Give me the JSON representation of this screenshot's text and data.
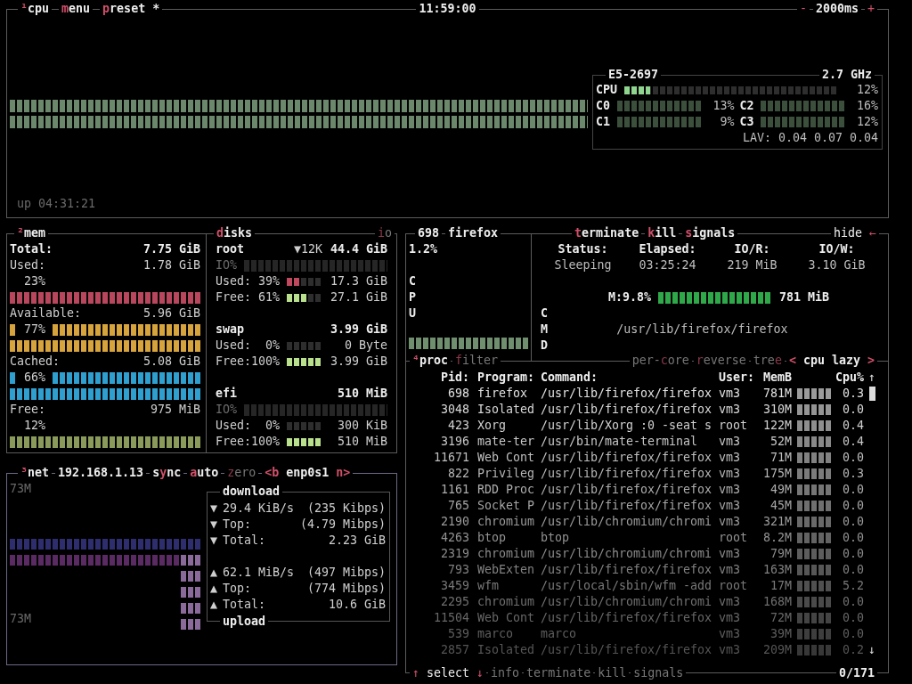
{
  "cpu_panel": {
    "tabs": [
      {
        "parts": [
          {
            "text": "¹",
            "hot": true
          },
          {
            "text": "cpu",
            "hot": false
          }
        ],
        "on": true
      },
      {
        "parts": [
          {
            "text": "m",
            "hot": true
          },
          {
            "text": "enu",
            "hot": false
          }
        ],
        "on": true
      },
      {
        "parts": [
          {
            "text": "p",
            "hot": true
          },
          {
            "text": "reset *",
            "hot": false
          }
        ],
        "on": true
      }
    ],
    "clock": "11:59:00",
    "interval": {
      "minus": "-",
      "value": "2000ms",
      "plus": "+"
    },
    "uptime": "up 04:31:21",
    "cpu_info": {
      "model": "E5-2697",
      "freq": "2.7 GHz",
      "total": {
        "label": "CPU",
        "level": 0.12,
        "reading": "12%"
      },
      "cores": [
        {
          "label": "C0",
          "reading": "13%"
        },
        {
          "label": "C2",
          "reading": "16%"
        },
        {
          "label": "C1",
          "reading": "9%"
        },
        {
          "label": "C3",
          "reading": "12%"
        }
      ],
      "load_average": "LAV: 0.04 0.07 0.04"
    }
  },
  "mem_panel": {
    "tab": {
      "parts": [
        {
          "text": "²",
          "hot": true
        },
        {
          "text": "mem",
          "hot": false
        }
      ],
      "on": true
    },
    "total": {
      "label": "Total:",
      "value": "7.75 GiB"
    },
    "stats": [
      {
        "kind": "short",
        "label": "Used:",
        "value": "1.78 GiB",
        "percent": "23%",
        "color": "#b8475e"
      },
      {
        "kind": "tall",
        "label": "Available:",
        "value": "5.96 GiB",
        "percent": "77%",
        "color": "#d6a33c"
      },
      {
        "kind": "tall",
        "label": "Cached:",
        "value": "5.08 GiB",
        "percent": "66%",
        "color": "#2f9fd0"
      },
      {
        "kind": "short",
        "label": "Free:",
        "value": "975 MiB",
        "percent": "12%",
        "color": "#8a9a5a"
      }
    ]
  },
  "disks_panel": {
    "tab": {
      "parts": [
        {
          "text": "d",
          "hot": true
        },
        {
          "text": "isks",
          "hot": false
        }
      ],
      "on": true
    },
    "io_tab": {
      "parts": [
        {
          "text": "i",
          "hot": true
        },
        {
          "text": "o",
          "hot": false
        }
      ],
      "on": false
    },
    "disks": [
      {
        "name": "root",
        "io_rate": "▼12K",
        "size": "44.4 GiB",
        "io_meter": true,
        "io_label": "IO%",
        "used": {
          "label": "Used: 39%",
          "level": 0.39,
          "value": "17.3 GiB"
        },
        "free": {
          "label": "Free: 61%",
          "level": 0.61,
          "value": "27.1 GiB"
        }
      },
      {
        "name": "swap",
        "size": "3.99 GiB",
        "io_meter": false,
        "used": {
          "label": "Used:  0%",
          "level": 0,
          "value": "0 Byte"
        },
        "free": {
          "label": "Free:100%",
          "level": 1,
          "value": "3.99 GiB"
        }
      },
      {
        "name": "efi",
        "size": "510 MiB",
        "io_meter": true,
        "io_label": "IO%",
        "used": {
          "label": "Used:  0%",
          "level": 0,
          "value": "300 KiB"
        },
        "free": {
          "label": "Free:100%",
          "level": 1,
          "value": "510 MiB"
        }
      }
    ]
  },
  "net_panel": {
    "tabs": [
      {
        "parts": [
          {
            "text": "³",
            "hot": true
          },
          {
            "text": "net",
            "hot": false
          }
        ],
        "on": true
      },
      {
        "parts": [
          {
            "text": "192.168.1.13",
            "hot": false
          }
        ],
        "on": true
      },
      {
        "parts": [
          {
            "text": "s",
            "hot": false
          },
          {
            "text": "y",
            "hot": true
          },
          {
            "text": "nc",
            "hot": false
          }
        ],
        "on": true
      },
      {
        "parts": [
          {
            "text": "a",
            "hot": true
          },
          {
            "text": "uto",
            "hot": false
          }
        ],
        "on": true
      },
      {
        "parts": [
          {
            "text": "z",
            "hot": true
          },
          {
            "text": "ero",
            "hot": false
          }
        ],
        "on": false
      },
      {
        "parts": [
          {
            "text": "<b",
            "hot": true
          },
          {
            "text": " enp0s1 ",
            "hot": false
          },
          {
            "text": "n>",
            "hot": true
          }
        ],
        "on": true
      }
    ],
    "scale_top": "73M",
    "scale_bottom": "73M",
    "download": {
      "title": "download",
      "rows": [
        {
          "arrow": "▼",
          "label": "29.4 KiB/s",
          "value": "(235 Kibps)"
        },
        {
          "arrow": "▼",
          "label": "Top:",
          "value": "(4.79 Mibps)"
        },
        {
          "arrow": "▼",
          "label": "Total:",
          "value": "2.23 GiB"
        }
      ]
    },
    "upload": {
      "title": "upload",
      "rows": [
        {
          "arrow": "▲",
          "label": "62.1 MiB/s",
          "value": "(497 Mibps)"
        },
        {
          "arrow": "▲",
          "label": "Top:",
          "value": "(774 Mibps)"
        },
        {
          "arrow": "▲",
          "label": "Total:",
          "value": "10.6 GiB"
        }
      ]
    }
  },
  "process_detail": {
    "pid": "698",
    "name": "firefox",
    "cpu": "1.2%",
    "cpu_label": "CPU",
    "buttons": [
      {
        "parts": [
          {
            "text": "t",
            "hot": true
          },
          {
            "text": "erminate",
            "hot": false
          }
        ],
        "on": true
      },
      {
        "parts": [
          {
            "text": "k",
            "hot": true
          },
          {
            "text": "ill",
            "hot": false
          }
        ],
        "on": true
      },
      {
        "parts": [
          {
            "text": "s",
            "hot": true
          },
          {
            "text": "ignals",
            "hot": false
          }
        ],
        "on": true
      }
    ],
    "hide": {
      "label": "hide",
      "arrow": "←"
    },
    "stats": [
      {
        "label": "Status:",
        "value": "Sleeping"
      },
      {
        "label": "Elapsed:",
        "value": "03:25:24"
      },
      {
        "label": "IO/R:",
        "value": "219 MiB"
      },
      {
        "label": "IO/W:",
        "value": "3.10 GiB"
      }
    ],
    "mem": {
      "label": "M:9.8%",
      "value": "781 MiB"
    },
    "cmd_label": "CMD",
    "command": "/usr/lib/firefox/firefox"
  },
  "process_list": {
    "tabs": [
      {
        "parts": [
          {
            "text": "⁴",
            "hot": true
          },
          {
            "text": "proc",
            "hot": false
          }
        ],
        "on": true
      },
      {
        "parts": [
          {
            "text": "f",
            "hot": true
          },
          {
            "text": "ilter",
            "hot": false
          }
        ],
        "on": false
      }
    ],
    "options": [
      {
        "parts": [
          {
            "text": "per-",
            "hot": false
          },
          {
            "text": "c",
            "hot": true
          },
          {
            "text": "ore",
            "hot": false
          }
        ],
        "on": false
      },
      {
        "parts": [
          {
            "text": "r",
            "hot": true
          },
          {
            "text": "everse",
            "hot": false
          }
        ],
        "on": false
      },
      {
        "parts": [
          {
            "text": "tre",
            "hot": false
          },
          {
            "text": "e",
            "hot": true
          }
        ],
        "on": false
      },
      {
        "parts": [
          {
            "text": "<",
            "hot": true
          },
          {
            "text": " cpu lazy ",
            "hot": false
          },
          {
            "text": ">",
            "hot": true
          }
        ],
        "on": true
      }
    ],
    "columns": [
      "Pid:",
      "Program:",
      "Command:",
      "User:",
      "MemB",
      "Cpu%"
    ],
    "rows": [
      {
        "pid": "698",
        "program": "firefox",
        "command": "/usr/lib/firefox/firefox",
        "user": "vm3",
        "mem": "781M",
        "cpu": "0.3"
      },
      {
        "pid": "3048",
        "program": "Isolated",
        "command": "/usr/lib/firefox/firefox",
        "user": "vm3",
        "mem": "310M",
        "cpu": "0.0"
      },
      {
        "pid": "423",
        "program": "Xorg",
        "command": "/usr/lib/Xorg :0 -seat s",
        "user": "root",
        "mem": "122M",
        "cpu": "0.4"
      },
      {
        "pid": "3196",
        "program": "mate-ter",
        "command": "/usr/bin/mate-terminal",
        "user": "vm3",
        "mem": "52M",
        "cpu": "0.4"
      },
      {
        "pid": "11671",
        "program": "Web Cont",
        "command": "/usr/lib/firefox/firefox",
        "user": "vm3",
        "mem": "71M",
        "cpu": "0.0"
      },
      {
        "pid": "822",
        "program": "Privileg",
        "command": "/usr/lib/firefox/firefox",
        "user": "vm3",
        "mem": "175M",
        "cpu": "0.3"
      },
      {
        "pid": "1161",
        "program": "RDD Proc",
        "command": "/usr/lib/firefox/firefox",
        "user": "vm3",
        "mem": "49M",
        "cpu": "0.0"
      },
      {
        "pid": "765",
        "program": "Socket P",
        "command": "/usr/lib/firefox/firefox",
        "user": "vm3",
        "mem": "45M",
        "cpu": "0.0"
      },
      {
        "pid": "2190",
        "program": "chromium",
        "command": "/usr/lib/chromium/chromi",
        "user": "vm3",
        "mem": "321M",
        "cpu": "0.0"
      },
      {
        "pid": "4263",
        "program": "btop",
        "command": "btop",
        "user": "root",
        "mem": "8.2M",
        "cpu": "0.0"
      },
      {
        "pid": "2319",
        "program": "chromium",
        "command": "/usr/lib/chromium/chromi",
        "user": "vm3",
        "mem": "79M",
        "cpu": "0.0"
      },
      {
        "pid": "793",
        "program": "WebExten",
        "command": "/usr/lib/firefox/firefox",
        "user": "vm3",
        "mem": "163M",
        "cpu": "0.0"
      },
      {
        "pid": "3459",
        "program": "wfm",
        "command": "/usr/local/sbin/wfm -add",
        "user": "root",
        "mem": "17M",
        "cpu": "5.2"
      },
      {
        "pid": "2295",
        "program": "chromium",
        "command": "/usr/lib/chromium/chromi",
        "user": "vm3",
        "mem": "168M",
        "cpu": "0.0"
      },
      {
        "pid": "11504",
        "program": "Web Cont",
        "command": "/usr/lib/firefox/firefox",
        "user": "vm3",
        "mem": "72M",
        "cpu": "0.0"
      },
      {
        "pid": "539",
        "program": "marco",
        "command": "marco",
        "user": "vm3",
        "mem": "39M",
        "cpu": "0.0"
      },
      {
        "pid": "2857",
        "program": "Isolated",
        "command": "/usr/lib/firefox/firefox",
        "user": "vm3",
        "mem": "209M",
        "cpu": "0.2"
      }
    ],
    "scroll": {
      "up": "↑",
      "down": "↓"
    },
    "select": {
      "up": "↑",
      "label": "select",
      "down": "↓"
    },
    "footer_tabs": [
      {
        "parts": [
          {
            "text": "info",
            "hot": false
          }
        ],
        "on": false
      },
      {
        "parts": [
          {
            "text": "terminate",
            "hot": false
          }
        ],
        "on": false
      },
      {
        "parts": [
          {
            "text": "kill",
            "hot": false
          }
        ],
        "on": false
      },
      {
        "parts": [
          {
            "text": "signals",
            "hot": false
          }
        ],
        "on": false
      }
    ],
    "count": "0/171"
  }
}
